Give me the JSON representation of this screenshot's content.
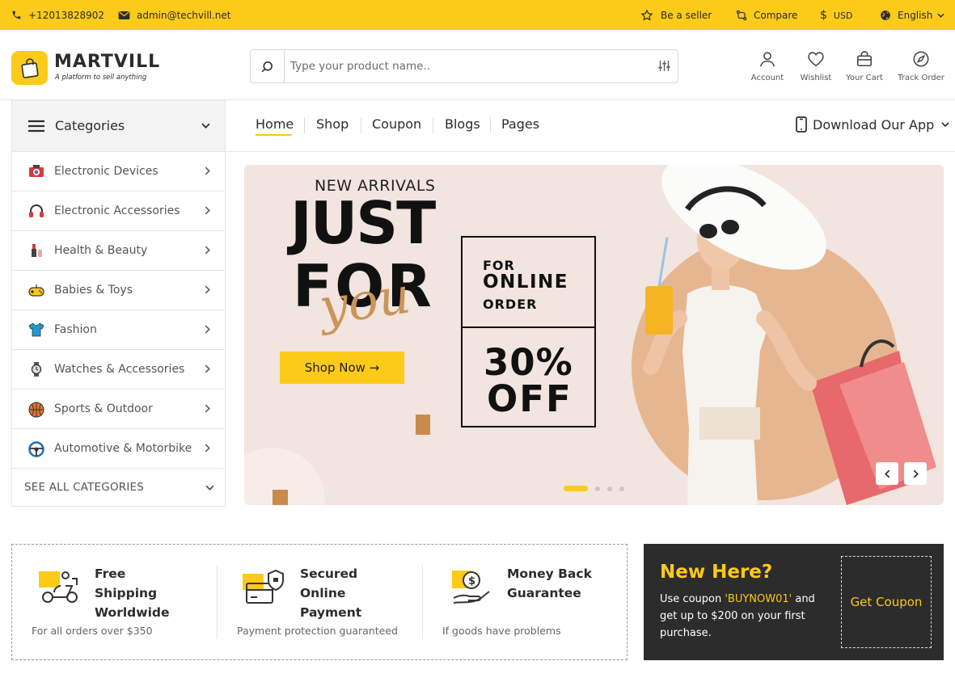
{
  "colors": {
    "accent": "#fcca19",
    "dark": "#2c2c2c",
    "hero_bg": "#f2e4de",
    "deco": "#c98a4e"
  },
  "topbar": {
    "phone": "+12013828902",
    "email": "admin@techvill.net",
    "seller": "Be a seller",
    "compare": "Compare",
    "currency_symbol": "$",
    "currency": "USD",
    "language": "English"
  },
  "header": {
    "logo_name": "MARTVILL",
    "logo_tagline": "A platform to sell anything",
    "search_placeholder": "Type your product name..",
    "actions": {
      "account": "Account",
      "wishlist": "Wishlist",
      "cart": "Your Cart",
      "track": "Track Order"
    }
  },
  "nav": {
    "categories_label": "Categories",
    "links": [
      "Home",
      "Shop",
      "Coupon",
      "Blogs",
      "Pages"
    ],
    "active": "Home",
    "download_app": "Download Our App"
  },
  "categories": {
    "items": [
      {
        "label": "Electronic Devices",
        "icon": "camera-icon"
      },
      {
        "label": "Electronic Accessories",
        "icon": "headphones-icon"
      },
      {
        "label": "Health & Beauty",
        "icon": "lipstick-icon"
      },
      {
        "label": "Babies & Toys",
        "icon": "gamepad-icon"
      },
      {
        "label": "Fashion",
        "icon": "tshirt-icon"
      },
      {
        "label": "Watches & Accessories",
        "icon": "watch-icon"
      },
      {
        "label": "Sports & Outdoor",
        "icon": "basketball-icon"
      },
      {
        "label": "Automotive & Motorbike",
        "icon": "steering-wheel-icon"
      }
    ],
    "see_all": "SEE ALL CATEGORIES"
  },
  "hero": {
    "eyebrow": "NEW ARRIVALS",
    "line1": "JUST",
    "line2": "FOR",
    "script": "you",
    "box_for": "FOR",
    "box_online": "ONLINE",
    "box_order": "ORDER",
    "discount": "30%",
    "off": "OFF",
    "cta": "Shop Now →",
    "slides": 4,
    "active_slide": 1
  },
  "features": [
    {
      "title": "Free Shipping Worldwide",
      "subtitle": "For all orders over $350",
      "icon": "delivery-scooter-icon"
    },
    {
      "title": "Secured Online Payment",
      "subtitle": "Payment protection guaranteed",
      "icon": "secure-card-icon"
    },
    {
      "title": "Money Back Guarantee",
      "subtitle": "If goods have problems",
      "icon": "money-hand-icon"
    }
  ],
  "coupon": {
    "heading": "New Here?",
    "text_before": "Use coupon ",
    "code": "'BUYNOW01'",
    "text_after": " and get up to $200 on your first purchase.",
    "button": "Get Coupon"
  }
}
